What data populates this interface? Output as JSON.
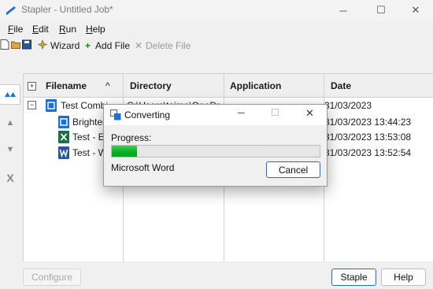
{
  "window": {
    "title": "Stapler - Untitled Job*",
    "controls": {
      "minimize": "─",
      "maximize": "☐",
      "close": "✕"
    }
  },
  "menu": [
    {
      "label": "File",
      "accel": "F",
      "rest": "ile"
    },
    {
      "label": "Edit",
      "accel": "E",
      "rest": "dit"
    },
    {
      "label": "Run",
      "accel": "R",
      "rest": "un"
    },
    {
      "label": "Help",
      "accel": "H",
      "rest": "elp"
    }
  ],
  "toolbar": {
    "wizard_label": "Wizard",
    "add_file_label": "Add File",
    "add_symbol": "+",
    "delete_file_label": "Delete File",
    "delete_symbol": "✕"
  },
  "side": {
    "up_symbol": "▲",
    "down_symbol": "▼",
    "remove_symbol": "X"
  },
  "grid": {
    "columns": [
      "Filename",
      "Directory",
      "Application",
      "Date"
    ],
    "header_expander": "+",
    "sort_indicator": "^",
    "parent": {
      "expander": "−",
      "name": "Test Combi",
      "directory": "C:\\Users\\taima\\OneDr",
      "date": "31/03/2023"
    },
    "children": [
      {
        "name": "Brighter",
        "icon": "stapler-doc-icon",
        "date": "31/03/2023 13:44:23"
      },
      {
        "name": "Test - E",
        "icon": "excel-icon",
        "date": "31/03/2023 13:53:08"
      },
      {
        "name": "Test - W",
        "icon": "word-icon",
        "date": "31/03/2023 13:52:54"
      }
    ]
  },
  "buttons": {
    "configure": "Configure",
    "staple": "Staple",
    "help": "Help"
  },
  "dialog": {
    "title": "Converting",
    "progress_label": "Progress:",
    "progress": 0.12,
    "current_item": "Microsoft Word",
    "cancel": "Cancel",
    "controls": {
      "minimize": "─",
      "maximize": "☐",
      "close": "✕"
    }
  },
  "colors": {
    "accent": "#1e6fd1",
    "progress": "#06b025",
    "excel": "#1d7044",
    "word": "#2b579a"
  }
}
